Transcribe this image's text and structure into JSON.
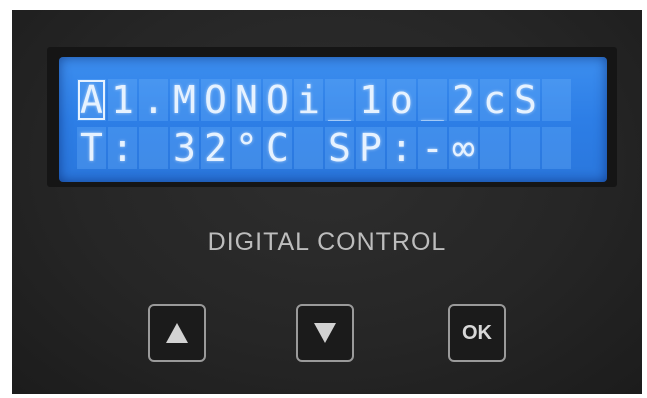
{
  "display": {
    "line1": [
      "A",
      "1",
      ".",
      "M",
      "O",
      "N",
      "O",
      "i",
      "_",
      "1",
      "o",
      "_",
      "2",
      "c",
      "S",
      " "
    ],
    "line2": [
      "T",
      ":",
      " ",
      "3",
      "2",
      "°",
      "C",
      " ",
      "S",
      "P",
      ":",
      "-",
      "∞",
      " ",
      " ",
      " "
    ],
    "cursor_position": 1,
    "backlight_color": "#2d7ee6",
    "text_color": "#e6f2ff"
  },
  "panel": {
    "label": "DIGITAL CONTROL"
  },
  "buttons": {
    "up": {
      "icon": "triangle-up-icon"
    },
    "down": {
      "icon": "triangle-down-icon"
    },
    "ok": {
      "label": "OK"
    }
  }
}
